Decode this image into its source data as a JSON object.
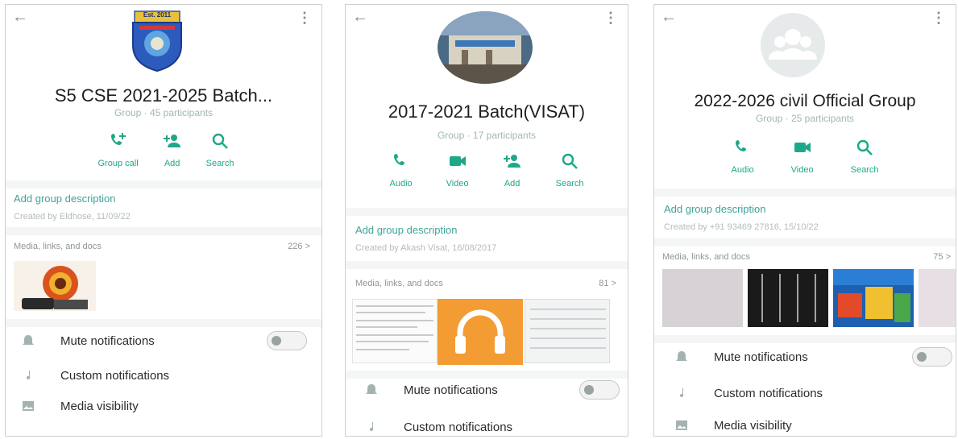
{
  "colors": {
    "accent": "#1ea88a",
    "link": "#3ea39a",
    "muted": "#a0b8b2"
  },
  "panels": [
    {
      "title": "S5 CSE 2021-2025 Batch...",
      "subtitle": "Group · 45 participants",
      "actions": [
        "Group call",
        "Add",
        "Search"
      ],
      "description_link": "Add group description",
      "created": "Created by Eldhose, 11/09/22",
      "media_label": "Media, links, and docs",
      "media_count": "226 >",
      "logo_text": "Est. 2011",
      "settings": [
        "Mute notifications",
        "Custom notifications",
        "Media visibility"
      ]
    },
    {
      "title": "2017-2021 Batch(VISAT)",
      "subtitle": "Group · 17 participants",
      "actions": [
        "Audio",
        "Video",
        "Add",
        "Search"
      ],
      "description_link": "Add group description",
      "created": "Created by Akash Visat, 16/08/2017",
      "media_label": "Media, links, and docs",
      "media_count": "81 >",
      "settings": [
        "Mute notifications",
        "Custom notifications"
      ]
    },
    {
      "title": "2022-2026 civil Official Group",
      "subtitle": "Group · 25 participants",
      "actions": [
        "Audio",
        "Video",
        "Search"
      ],
      "description_link": "Add group description",
      "created": "Created by +91 93469 27816, 15/10/22",
      "media_label": "Media, links, and docs",
      "media_count": "75 >",
      "settings": [
        "Mute notifications",
        "Custom notifications",
        "Media visibility"
      ]
    }
  ]
}
